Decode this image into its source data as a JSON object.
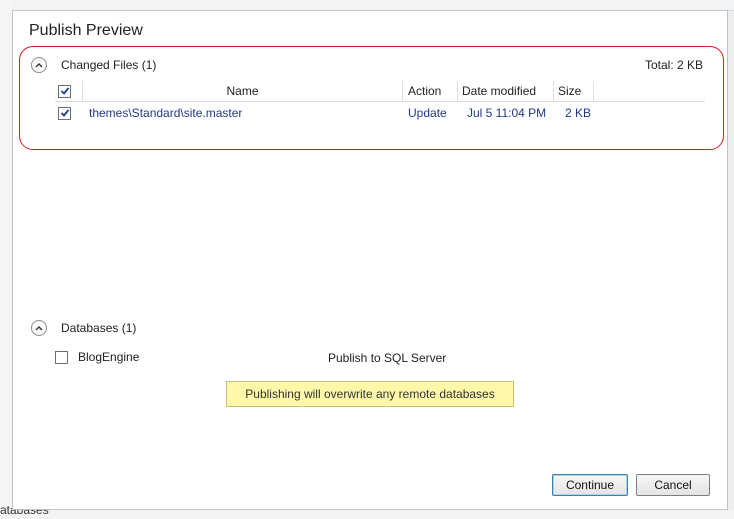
{
  "dialog": {
    "title": "Publish Preview",
    "continue_label": "Continue",
    "cancel_label": "Cancel"
  },
  "changed_files": {
    "header": "Changed Files (1)",
    "total": "Total: 2 KB",
    "columns": {
      "name": "Name",
      "action": "Action",
      "date": "Date modified",
      "size": "Size"
    },
    "select_all_checked": true,
    "rows": [
      {
        "checked": true,
        "name": "themes\\Standard\\site.master",
        "action": "Update",
        "date": "Jul 5 11:04 PM",
        "size": "2 KB"
      }
    ]
  },
  "databases": {
    "header": "Databases (1)",
    "rows": [
      {
        "checked": false,
        "name": "BlogEngine",
        "target": "Publish to SQL Server"
      }
    ],
    "warning": "Publishing will overwrite any remote databases"
  },
  "background": {
    "bottom_label": "atabases"
  },
  "colors": {
    "highlight": "#e01b1b",
    "link_text": "#1f3a8a",
    "warning_bg": "#fff8a8"
  },
  "icons": {
    "collapse": "chevron-up-icon",
    "checkmark": "checkmark-icon"
  }
}
